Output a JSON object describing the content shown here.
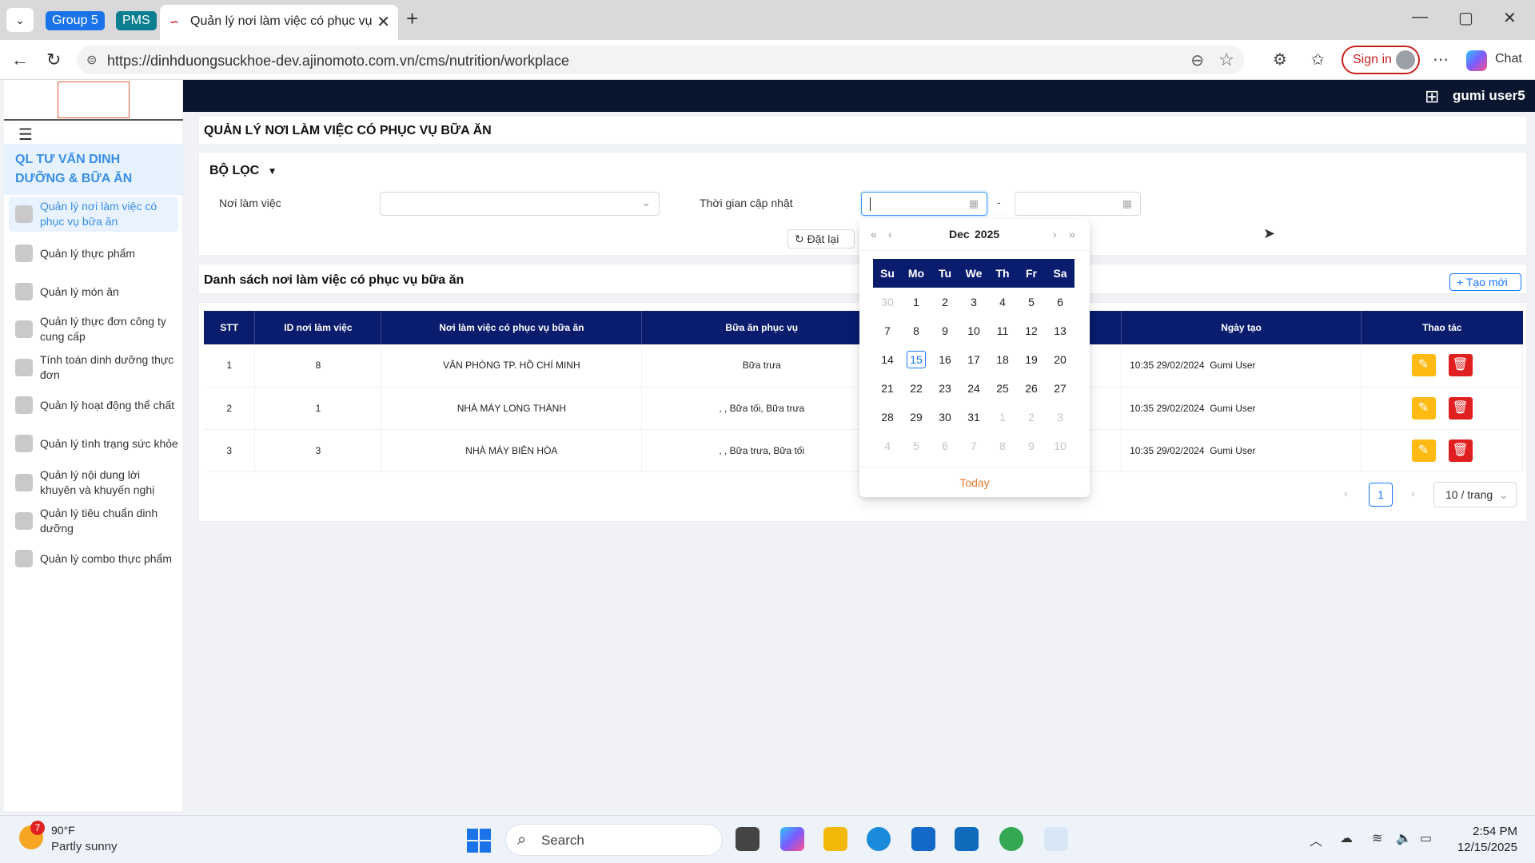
{
  "browser": {
    "tab_groups": [
      "Group 5",
      "PMS"
    ],
    "active_tab_title": "Quản lý nơi làm việc có phục vụ bữa",
    "url": "https://dinhduongsuckhoe-dev.ajinomoto.com.vn/cms/nutrition/workplace",
    "sign_in": "Sign in",
    "chat": "Chat"
  },
  "app": {
    "user": "gumi user5",
    "sidebar": {
      "section": "QL TƯ VẤN DINH DƯỠNG & BỮA ĂN",
      "items": [
        {
          "label": "Quản lý nơi làm việc có phục vụ bữa ăn"
        },
        {
          "label": "Quản lý thực phẩm"
        },
        {
          "label": "Quản lý món ăn"
        },
        {
          "label": "Quản lý thực đơn công ty cung cấp"
        },
        {
          "label": "Tính toán dinh dưỡng thực đơn"
        },
        {
          "label": "Quản lý hoạt động thể chất"
        },
        {
          "label": "Quản lý tình trạng sức khỏe"
        },
        {
          "label": "Quản lý nội dung lời khuyên và khuyến nghị"
        },
        {
          "label": "Quản lý tiêu chuẩn dinh dưỡng"
        },
        {
          "label": "Quản lý combo thực phẩm"
        }
      ]
    },
    "page_title": "QUẢN LÝ NƠI LÀM VIỆC CÓ PHỤC VỤ BỮA ĂN",
    "filter": {
      "title": "BỘ LỌC",
      "workplace_label": "Nơi làm việc",
      "workplace_value": "",
      "updated_label": "Thời gian cập nhật",
      "date_from": "",
      "date_to": "",
      "range_sep": "-",
      "reset": "Đặt lại"
    },
    "list": {
      "title": "Danh sách nơi làm việc có phục vụ bữa ăn",
      "create": "Tạo mới",
      "columns": [
        "STT",
        "ID nơi làm việc",
        "Nơi làm việc có phục vụ bữa ăn",
        "Bữa ăn phục vụ",
        "",
        "Ngày tạo",
        "Thao tác"
      ],
      "rows": [
        {
          "stt": "1",
          "id": "8",
          "name": "VĂN PHÒNG TP. HỒ CHÍ MINH",
          "meals": "Bữa trưa",
          "created_time": "10:35 29/02/2024",
          "created_by": "Gumi User"
        },
        {
          "stt": "2",
          "id": "1",
          "name": "NHÀ MÁY LONG THÀNH",
          "meals": ", , Bữa tối, Bữa trưa",
          "created_time": "10:35 29/02/2024",
          "created_by": "Gumi User"
        },
        {
          "stt": "3",
          "id": "3",
          "name": "NHÀ MÁY BIÊN HÒA",
          "meals": ", , Bữa trưa, Bữa tối",
          "created_time": "10:35 29/02/2024",
          "created_by": "Gumi User"
        }
      ],
      "page": "1",
      "page_size": "10 / trang"
    },
    "datepicker": {
      "month": "Dec",
      "year": "2025",
      "weekdays": [
        "Su",
        "Mo",
        "Tu",
        "We",
        "Th",
        "Fr",
        "Sa"
      ],
      "weeks": [
        [
          "30",
          "1",
          "2",
          "3",
          "4",
          "5",
          "6"
        ],
        [
          "7",
          "8",
          "9",
          "10",
          "11",
          "12",
          "13"
        ],
        [
          "14",
          "15",
          "16",
          "17",
          "18",
          "19",
          "20"
        ],
        [
          "21",
          "22",
          "23",
          "24",
          "25",
          "26",
          "27"
        ],
        [
          "28",
          "29",
          "30",
          "31",
          "1",
          "2",
          "3"
        ],
        [
          "4",
          "5",
          "6",
          "7",
          "8",
          "9",
          "10"
        ]
      ],
      "today": "Today"
    }
  },
  "taskbar": {
    "temperature": "90°F",
    "weather": "Partly sunny",
    "weather_badge": "7",
    "search": "Search",
    "time": "2:54 PM",
    "date": "12/15/2025"
  },
  "colors": {
    "navy": "#0a1530",
    "table_header": "#0a1c6e",
    "accent_blue": "#1677ff",
    "edit": "#ffbb14",
    "delete": "#e02020"
  }
}
